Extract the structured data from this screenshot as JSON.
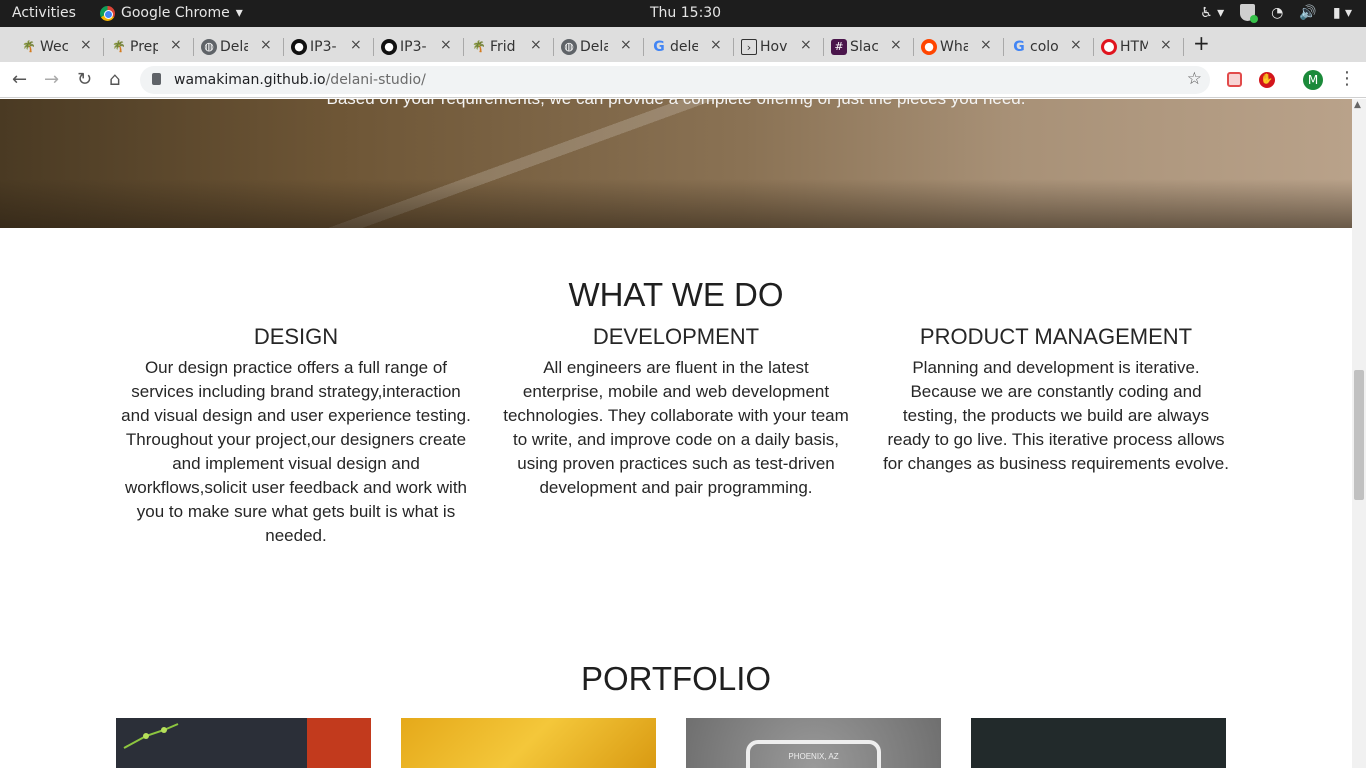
{
  "system_bar": {
    "activities": "Activities",
    "app_name": "Google Chrome",
    "app_menu_arrow": "▾",
    "clock": "Thu 15:30",
    "tray_icons": [
      "accessibility-icon",
      "shield-icon",
      "wifi-icon",
      "volume-icon",
      "battery-icon"
    ]
  },
  "browser": {
    "tabs": [
      {
        "label": "Wec",
        "icon": "tree-icon"
      },
      {
        "label": "Prep",
        "icon": "tree-icon"
      },
      {
        "label": "Dela",
        "icon": "globe-icon"
      },
      {
        "label": "IP3-",
        "icon": "github-icon"
      },
      {
        "label": "IP3-",
        "icon": "github-icon"
      },
      {
        "label": "Frid",
        "icon": "tree-icon"
      },
      {
        "label": "Dela",
        "icon": "globe-icon"
      },
      {
        "label": "dele",
        "icon": "google-icon"
      },
      {
        "label": "Hov",
        "icon": "terminal-icon"
      },
      {
        "label": "Slac",
        "icon": "slack-icon"
      },
      {
        "label": "Wha",
        "icon": "reddit-icon"
      },
      {
        "label": "colo",
        "icon": "google-icon"
      },
      {
        "label": "HTM",
        "icon": "opera-icon"
      }
    ],
    "tab_close": "×",
    "new_tab": "+",
    "url_host": "wamakiman.github.io",
    "url_path": "/delani-studio/",
    "profile_initial": "M"
  },
  "page": {
    "hero_caption": "Based on your requirements, we can provide a complete offering or just the pieces you need.",
    "what_we_do": {
      "title": "WHAT WE DO",
      "services": [
        {
          "heading": "DESIGN",
          "text": "Our design practice offers a full range of services including brand strategy,interaction and visual design and user experience testing. Throughout your project,our designers create and implement visual design and workflows,solicit user feedback and work with you to make sure what gets built is what is needed."
        },
        {
          "heading": "DEVELOPMENT",
          "text": "All engineers are fluent in the latest enterprise, mobile and web development technologies. They collaborate with your team to write, and improve code on a daily basis, using proven practices such as test-driven development and pair programming."
        },
        {
          "heading": "PRODUCT MANAGEMENT",
          "text": "Planning and development is iterative. Because we are constantly coding and testing, the products we build are always ready to go live. This iterative process allows for changes as business requirements evolve."
        }
      ]
    },
    "portfolio": {
      "title": "PORTFOLIO",
      "tile_badge": "PHOENIX, AZ"
    }
  },
  "colors": {
    "topbar_bg": "#1d1d1d",
    "tabstrip_bg": "#dedede",
    "heading_text": "#1f1f1f"
  }
}
